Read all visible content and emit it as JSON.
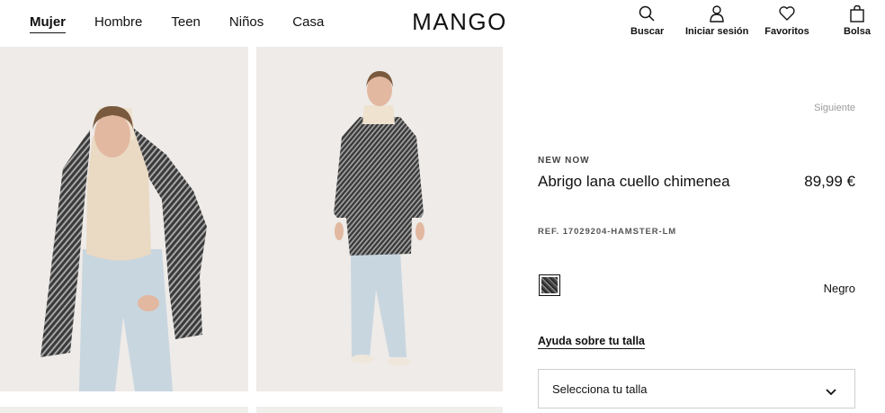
{
  "brand": "MANGO",
  "nav": {
    "items": [
      {
        "label": "Mujer",
        "active": true
      },
      {
        "label": "Hombre"
      },
      {
        "label": "Teen"
      },
      {
        "label": "Niños"
      },
      {
        "label": "Casa"
      }
    ]
  },
  "tools": {
    "search": {
      "label": "Buscar",
      "icon": "search-icon"
    },
    "login": {
      "label": "Iniciar sesión",
      "icon": "user-icon"
    },
    "favorites": {
      "label": "Favoritos",
      "icon": "heart-icon"
    },
    "bag": {
      "label": "Bolsa",
      "icon": "bag-icon"
    }
  },
  "product": {
    "next_label": "Siguiente",
    "tag": "NEW NOW",
    "title": "Abrigo lana cuello chimenea",
    "price": "89,99 €",
    "ref": "REF. 17029204-HAMSTER-LM",
    "color": "Negro",
    "size_help": "Ayuda sobre tu talla",
    "size_select": "Selecciona tu talla"
  },
  "colors": {
    "text": "#111111",
    "image_bg": "#eeebe8",
    "muted": "#9a9a9a"
  }
}
